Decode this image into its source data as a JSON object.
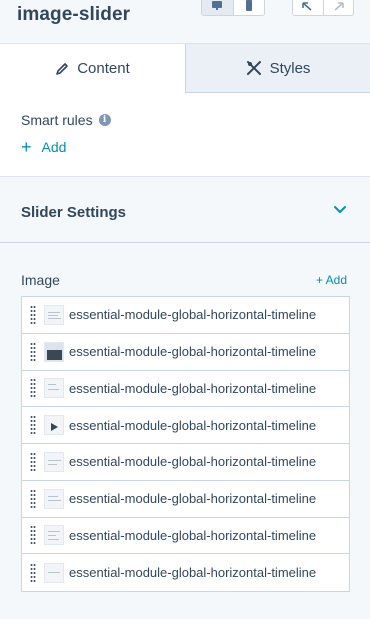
{
  "header": {
    "title": "image-slider",
    "view_desktop_icon": "desktop-icon",
    "view_mobile_icon": "mobile-icon",
    "undo_icon": "undo-icon",
    "redo_icon": "redo-icon"
  },
  "tabs": [
    {
      "label": "Content",
      "icon": "pencil-icon",
      "active": true
    },
    {
      "label": "Styles",
      "icon": "styles-icon",
      "active": false
    }
  ],
  "smart_rules": {
    "label": "Smart rules",
    "add_label": "Add"
  },
  "slider_settings": {
    "label": "Slider Settings"
  },
  "image": {
    "label": "Image",
    "add_label": "+ Add",
    "items": [
      {
        "name": "essential-module-global-horizontal-timeline"
      },
      {
        "name": "essential-module-global-horizontal-timeline"
      },
      {
        "name": "essential-module-global-horizontal-timeline"
      },
      {
        "name": "essential-module-global-horizontal-timeline"
      },
      {
        "name": "essential-module-global-horizontal-timeline"
      },
      {
        "name": "essential-module-global-horizontal-timeline"
      },
      {
        "name": "essential-module-global-horizontal-timeline"
      },
      {
        "name": "essential-module-global-horizontal-timeline"
      }
    ]
  },
  "colors": {
    "accent": "#0091ae",
    "text": "#33475b",
    "border": "#cbd6e2",
    "panel_bg": "#f5f8fa"
  }
}
